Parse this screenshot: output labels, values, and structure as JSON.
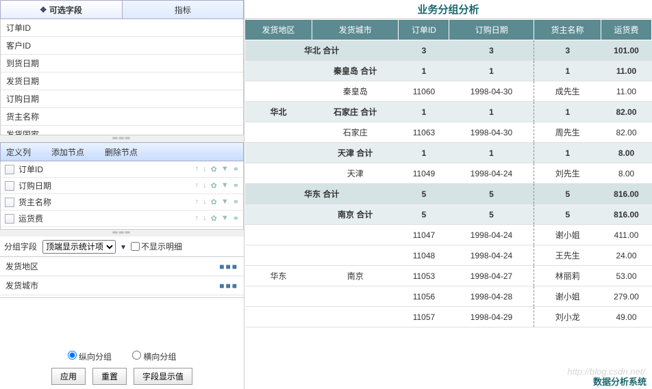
{
  "tabs": {
    "optional": "可选字段",
    "metrics": "指标"
  },
  "fields": [
    "订单ID",
    "客户ID",
    "到货日期",
    "发货日期",
    "订购日期",
    "货主名称",
    "发货国家"
  ],
  "defcol": {
    "title": "定义列",
    "add": "添加节点",
    "del": "删除节点",
    "items": [
      "订单ID",
      "订购日期",
      "货主名称",
      "运货费"
    ]
  },
  "group": {
    "label": "分组字段",
    "select": "顶端显示统计项",
    "nohint": "不显示明细",
    "items": [
      "发货地区",
      "发货城市"
    ]
  },
  "radios": {
    "v": "纵向分组",
    "h": "横向分组"
  },
  "buttons": {
    "apply": "应用",
    "reset": "重置",
    "show": "字段显示值"
  },
  "rtitle": "业务分组分析",
  "headers": [
    "发货地区",
    "发货城市",
    "订单ID",
    "订购日期",
    "货主名称",
    "运货费"
  ],
  "rows": [
    {
      "cls": "shade",
      "c": [
        "华北 合计",
        "",
        "3",
        "3",
        "3",
        "101.00"
      ],
      "span": [
        2,
        0,
        1,
        1,
        1,
        1
      ]
    },
    {
      "cls": "shade2",
      "c": [
        "",
        "秦皇岛 合计",
        "1",
        "1",
        "1",
        "11.00"
      ]
    },
    {
      "cls": "",
      "c": [
        "",
        "秦皇岛",
        "11060",
        "1998-04-30",
        "成先生",
        "11.00"
      ]
    },
    {
      "cls": "shade2",
      "c": [
        "",
        "石家庄 合计",
        "1",
        "1",
        "1",
        "82.00"
      ]
    },
    {
      "cls": "",
      "c": [
        "",
        "石家庄",
        "11063",
        "1998-04-30",
        "周先生",
        "82.00"
      ]
    },
    {
      "cls": "shade2",
      "c": [
        "",
        "天津 合计",
        "1",
        "1",
        "1",
        "8.00"
      ]
    },
    {
      "cls": "",
      "c": [
        "",
        "天津",
        "11049",
        "1998-04-24",
        "刘先生",
        "8.00"
      ]
    },
    {
      "cls": "shade",
      "c": [
        "华东 合计",
        "",
        "5",
        "5",
        "5",
        "816.00"
      ],
      "span": [
        2,
        0,
        1,
        1,
        1,
        1
      ]
    },
    {
      "cls": "shade2",
      "c": [
        "",
        "南京 合计",
        "5",
        "5",
        "5",
        "816.00"
      ]
    },
    {
      "cls": "",
      "c": [
        "",
        "",
        "11047",
        "1998-04-24",
        "谢小姐",
        "411.00"
      ]
    },
    {
      "cls": "",
      "c": [
        "",
        "",
        "11048",
        "1998-04-24",
        "王先生",
        "24.00"
      ]
    },
    {
      "cls": "",
      "c": [
        "",
        "",
        "11053",
        "1998-04-27",
        "林丽莉",
        "53.00"
      ]
    },
    {
      "cls": "",
      "c": [
        "",
        "",
        "11056",
        "1998-04-28",
        "谢小姐",
        "279.00"
      ]
    },
    {
      "cls": "",
      "c": [
        "",
        "",
        "11057",
        "1998-04-29",
        "刘小龙",
        "49.00"
      ]
    }
  ],
  "region_labels": {
    "r1": "华北",
    "r2": "华东",
    "r2city": "南京"
  },
  "footer": "数据分析系统",
  "watermark": "http://blog.csdn.net/"
}
